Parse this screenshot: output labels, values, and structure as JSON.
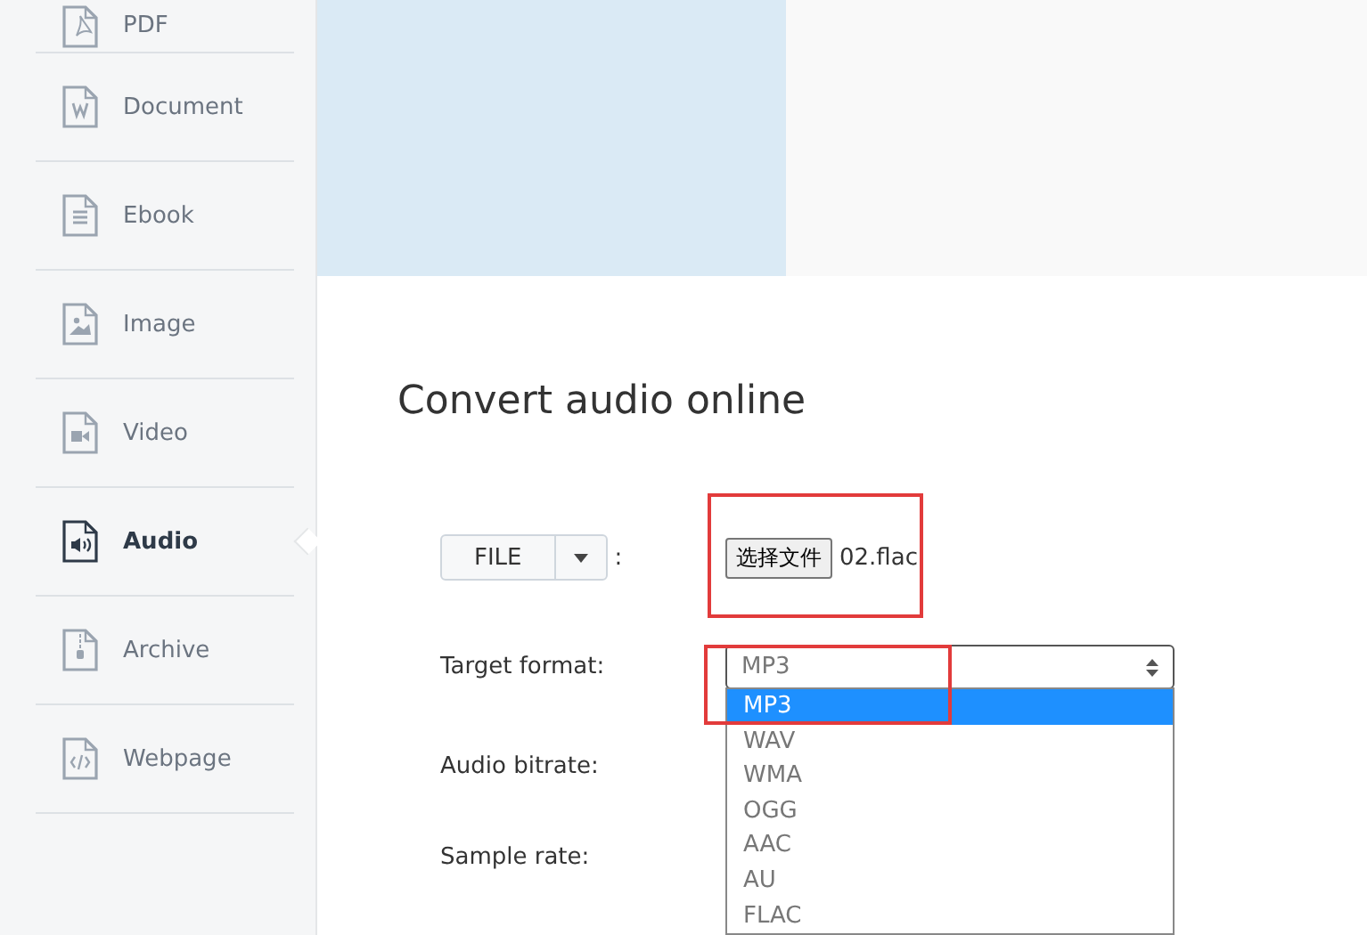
{
  "sidebar": {
    "items": [
      {
        "label": "PDF",
        "kind": "pdf",
        "selected": false
      },
      {
        "label": "Document",
        "kind": "document",
        "selected": false
      },
      {
        "label": "Ebook",
        "kind": "ebook",
        "selected": false
      },
      {
        "label": "Image",
        "kind": "image",
        "selected": false
      },
      {
        "label": "Video",
        "kind": "video",
        "selected": false
      },
      {
        "label": "Audio",
        "kind": "audio",
        "selected": true
      },
      {
        "label": "Archive",
        "kind": "archive",
        "selected": false
      },
      {
        "label": "Webpage",
        "kind": "webpage",
        "selected": false
      }
    ]
  },
  "title": "Convert audio online",
  "source": {
    "button": "FILE",
    "colon": ":",
    "file_button": "选择文件",
    "file_name": "02.flac"
  },
  "fields": [
    {
      "label": "Target format:",
      "value": "MP3",
      "expanded": true,
      "options": [
        {
          "label": "MP3",
          "selected": true
        },
        {
          "label": "WAV",
          "selected": false
        },
        {
          "label": "WMA",
          "selected": false
        },
        {
          "label": "OGG",
          "selected": false
        },
        {
          "label": "AAC",
          "selected": false
        },
        {
          "label": "AU",
          "selected": false
        },
        {
          "label": "FLAC",
          "selected": false
        }
      ]
    },
    {
      "label": "Audio bitrate:"
    },
    {
      "label": "Sample rate:"
    }
  ]
}
